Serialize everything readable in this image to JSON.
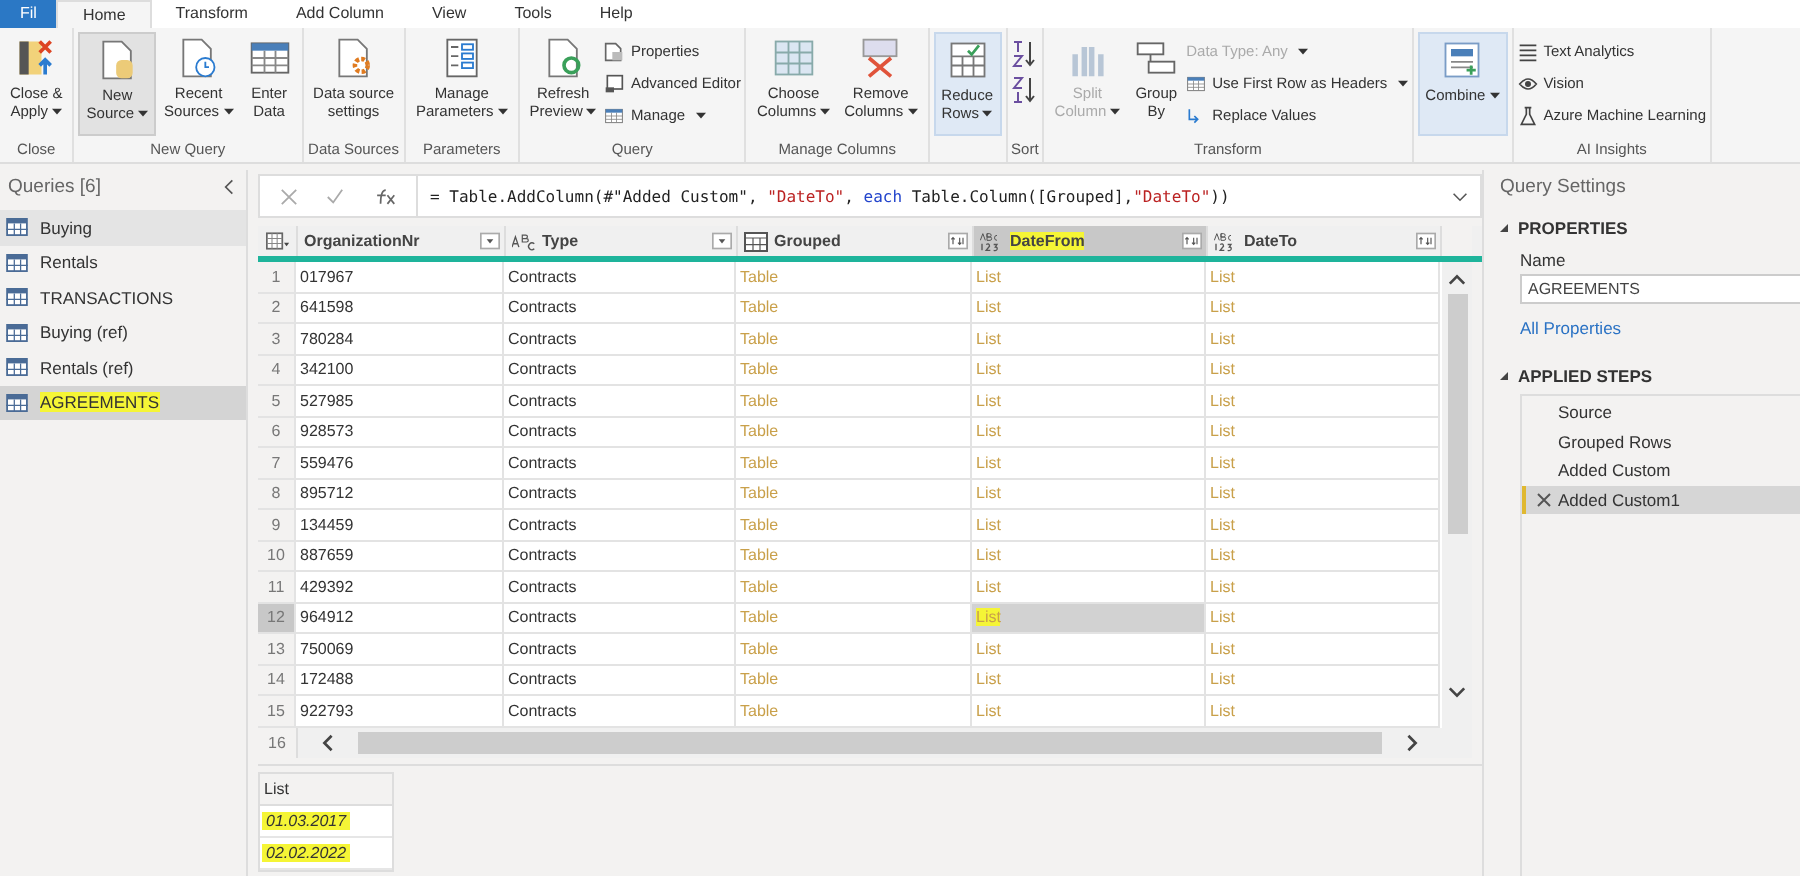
{
  "menu_tabs": [
    {
      "label": "Fil",
      "kind": "file",
      "selected": false
    },
    {
      "label": "Home",
      "kind": "tab",
      "selected": true
    },
    {
      "label": "Transform",
      "kind": "tab",
      "selected": false
    },
    {
      "label": "Add Column",
      "kind": "tab",
      "selected": false
    },
    {
      "label": "View",
      "kind": "tab",
      "selected": false
    },
    {
      "label": "Tools",
      "kind": "tab",
      "selected": false
    },
    {
      "label": "Help",
      "kind": "tab",
      "selected": false
    }
  ],
  "ribbon": {
    "groups": [
      {
        "label": "Close",
        "items": [
          {
            "kind": "large",
            "lines": [
              "Close &",
              "Apply"
            ],
            "dropdown": true,
            "disabled": false,
            "hovered": false,
            "pressed": false
          }
        ]
      },
      {
        "label": "New Query",
        "items": [
          {
            "kind": "large",
            "lines": [
              "New",
              "Source"
            ],
            "dropdown": true,
            "disabled": false,
            "hovered": true,
            "pressed": false
          },
          {
            "kind": "large",
            "lines": [
              "Recent",
              "Sources"
            ],
            "dropdown": true,
            "disabled": false,
            "hovered": false,
            "pressed": false
          },
          {
            "kind": "large",
            "lines": [
              "Enter",
              "Data"
            ],
            "dropdown": false,
            "disabled": false,
            "hovered": false,
            "pressed": false
          }
        ]
      },
      {
        "label": "Data Sources",
        "items": [
          {
            "kind": "large",
            "lines": [
              "Data source",
              "settings"
            ],
            "dropdown": false,
            "disabled": false,
            "hovered": false,
            "pressed": false
          }
        ]
      },
      {
        "label": "Parameters",
        "items": [
          {
            "kind": "large",
            "lines": [
              "Manage",
              "Parameters"
            ],
            "dropdown": true,
            "disabled": false,
            "hovered": false,
            "pressed": false
          }
        ]
      },
      {
        "label": "Query",
        "items": [
          {
            "kind": "large",
            "lines": [
              "Refresh",
              "Preview"
            ],
            "dropdown": true,
            "disabled": false,
            "hovered": false,
            "pressed": false
          },
          {
            "kind": "stack",
            "entries": [
              {
                "label": "Properties",
                "dropdown": false,
                "disabled": false
              },
              {
                "label": "Advanced Editor",
                "dropdown": false,
                "disabled": false
              },
              {
                "label": "Manage",
                "dropdown": true,
                "disabled": false
              }
            ]
          }
        ]
      },
      {
        "label": "Manage Columns",
        "items": [
          {
            "kind": "large",
            "lines": [
              "Choose",
              "Columns"
            ],
            "dropdown": true,
            "disabled": false,
            "hovered": false,
            "pressed": false
          },
          {
            "kind": "large",
            "lines": [
              "Remove",
              "Columns"
            ],
            "dropdown": true,
            "disabled": false,
            "hovered": false,
            "pressed": false
          }
        ]
      },
      {
        "items": [
          {
            "kind": "large",
            "lines": [
              "Reduce",
              "Rows"
            ],
            "dropdown": true,
            "disabled": false,
            "hovered": false,
            "pressed": true
          }
        ]
      },
      {
        "label": "Sort",
        "items": [
          {
            "kind": "sort-icons"
          }
        ]
      },
      {
        "label": "Transform",
        "items": [
          {
            "kind": "large",
            "lines": [
              "Split",
              "Column"
            ],
            "dropdown": true,
            "disabled": true,
            "hovered": false,
            "pressed": false
          },
          {
            "kind": "large",
            "lines": [
              "Group",
              "By"
            ],
            "dropdown": false,
            "disabled": false,
            "hovered": false,
            "pressed": false
          },
          {
            "kind": "stack",
            "entries": [
              {
                "label": "Data Type: Any",
                "dropdown": true,
                "disabled": true
              },
              {
                "label": "Use First Row as Headers",
                "dropdown": true,
                "disabled": false
              },
              {
                "label": "Replace Values",
                "dropdown": false,
                "disabled": false
              }
            ]
          }
        ]
      },
      {
        "items": [
          {
            "kind": "large",
            "lines": [
              "Combine"
            ],
            "dropdown": true,
            "disabled": false,
            "hovered": false,
            "pressed": true
          }
        ]
      },
      {
        "label": "AI Insights",
        "items": [
          {
            "kind": "stack",
            "entries": [
              {
                "label": "Text Analytics",
                "dropdown": false,
                "disabled": false
              },
              {
                "label": "Vision",
                "dropdown": false,
                "disabled": false
              },
              {
                "label": "Azure Machine Learning",
                "dropdown": false,
                "disabled": false
              }
            ]
          }
        ]
      }
    ]
  },
  "queries": {
    "title": "Queries [6]",
    "items": [
      {
        "name": "Buying",
        "selected": false,
        "hovered": true,
        "highlighted": false
      },
      {
        "name": "Rentals",
        "selected": false,
        "hovered": false,
        "highlighted": false
      },
      {
        "name": "TRANSACTIONS",
        "selected": false,
        "hovered": false,
        "highlighted": false
      },
      {
        "name": "Buying (ref)",
        "selected": false,
        "hovered": false,
        "highlighted": false
      },
      {
        "name": "Rentals (ref)",
        "selected": false,
        "hovered": false,
        "highlighted": false
      },
      {
        "name": "AGREEMENTS",
        "selected": true,
        "hovered": false,
        "highlighted": true
      }
    ]
  },
  "formula": {
    "segments": [
      {
        "text": "= Table.AddColumn(#\"Added Custom\", ",
        "kind": "code"
      },
      {
        "text": "\"DateTo\"",
        "kind": "string"
      },
      {
        "text": ", ",
        "kind": "code"
      },
      {
        "text": "each",
        "kind": "keyword"
      },
      {
        "text": " Table.Column([Grouped],",
        "kind": "code"
      },
      {
        "text": "\"DateTo\"",
        "kind": "string"
      },
      {
        "text": "))",
        "kind": "code"
      }
    ]
  },
  "table": {
    "columns": [
      {
        "name": "OrganizationNr",
        "kind": "number",
        "selected": false,
        "highlighted": false
      },
      {
        "name": "Type",
        "kind": "text",
        "selected": false,
        "highlighted": false
      },
      {
        "name": "Grouped",
        "kind": "table",
        "selected": false,
        "highlighted": false
      },
      {
        "name": "DateFrom",
        "kind": "list",
        "selected": true,
        "highlighted": true
      },
      {
        "name": "DateTo",
        "kind": "list",
        "selected": false,
        "highlighted": false
      }
    ],
    "rows": [
      {
        "n": "1",
        "selected": false,
        "cells": [
          "017967",
          "Contracts",
          "Table",
          "List",
          "List"
        ]
      },
      {
        "n": "2",
        "selected": false,
        "cells": [
          "641598",
          "Contracts",
          "Table",
          "List",
          "List"
        ]
      },
      {
        "n": "3",
        "selected": false,
        "cells": [
          "780284",
          "Contracts",
          "Table",
          "List",
          "List"
        ]
      },
      {
        "n": "4",
        "selected": false,
        "cells": [
          "342100",
          "Contracts",
          "Table",
          "List",
          "List"
        ]
      },
      {
        "n": "5",
        "selected": false,
        "cells": [
          "527985",
          "Contracts",
          "Table",
          "List",
          "List"
        ]
      },
      {
        "n": "6",
        "selected": false,
        "cells": [
          "928573",
          "Contracts",
          "Table",
          "List",
          "List"
        ]
      },
      {
        "n": "7",
        "selected": false,
        "cells": [
          "559476",
          "Contracts",
          "Table",
          "List",
          "List"
        ]
      },
      {
        "n": "8",
        "selected": false,
        "cells": [
          "895712",
          "Contracts",
          "Table",
          "List",
          "List"
        ]
      },
      {
        "n": "9",
        "selected": false,
        "cells": [
          "134459",
          "Contracts",
          "Table",
          "List",
          "List"
        ]
      },
      {
        "n": "10",
        "selected": false,
        "cells": [
          "887659",
          "Contracts",
          "Table",
          "List",
          "List"
        ]
      },
      {
        "n": "11",
        "selected": false,
        "cells": [
          "429392",
          "Contracts",
          "Table",
          "List",
          "List"
        ]
      },
      {
        "n": "12",
        "selected": true,
        "cells": [
          "964912",
          "Contracts",
          "Table",
          "List",
          "List"
        ]
      },
      {
        "n": "13",
        "selected": false,
        "cells": [
          "750069",
          "Contracts",
          "Table",
          "List",
          "List"
        ]
      },
      {
        "n": "14",
        "selected": false,
        "cells": [
          "172488",
          "Contracts",
          "Table",
          "List",
          "List"
        ]
      },
      {
        "n": "15",
        "selected": false,
        "cells": [
          "922793",
          "Contracts",
          "Table",
          "List",
          "List"
        ]
      }
    ],
    "next_row_number": "16"
  },
  "preview": {
    "header": "List",
    "values": [
      {
        "text": "01.03.2017",
        "highlighted": true
      },
      {
        "text": "02.02.2022",
        "highlighted": true
      }
    ]
  },
  "settings": {
    "title": "Query Settings",
    "properties": {
      "title": "PROPERTIES",
      "name_label": "Name",
      "name_value": "AGREEMENTS",
      "link": "All Properties"
    },
    "steps": {
      "title": "APPLIED STEPS",
      "items": [
        {
          "name": "Source",
          "selected": false
        },
        {
          "name": "Grouped Rows",
          "selected": false
        },
        {
          "name": "Added Custom",
          "selected": false
        },
        {
          "name": "Added Custom1",
          "selected": true
        }
      ]
    }
  }
}
